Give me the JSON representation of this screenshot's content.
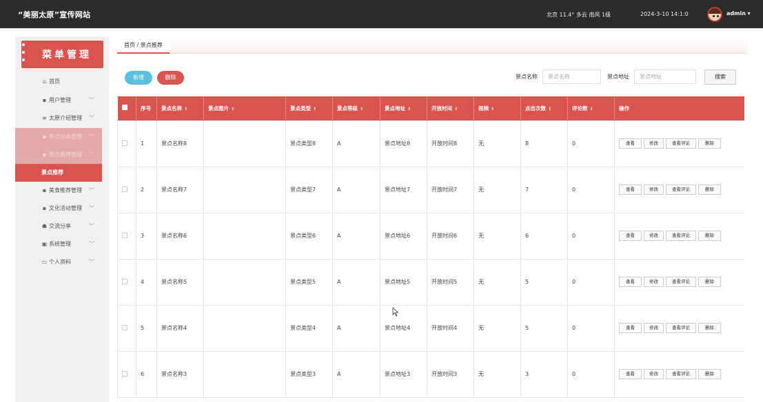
{
  "header": {
    "site_title": "“美丽太原”宣传网站",
    "weather": "北京 11.4° 多云 南风 1级",
    "datetime": "2024-3-10 14:1:0",
    "user": "admin ▾"
  },
  "sidebar": {
    "menu_title": "菜单管理",
    "items": [
      {
        "label": "首页",
        "icon": "home-icon",
        "chevron": ""
      },
      {
        "label": "用户管理",
        "icon": "grid-icon",
        "chevron": "﹀"
      },
      {
        "label": "太原介绍管理",
        "icon": "list-icon",
        "chevron": "﹀"
      },
      {
        "label": "景点分类管理",
        "icon": "grid-icon",
        "chevron": "﹀"
      },
      {
        "label": "景点推荐管理",
        "icon": "grid-icon",
        "chevron": "﹀"
      },
      {
        "label": "景点推荐",
        "icon": "",
        "chevron": ""
      },
      {
        "label": "美食推荐管理",
        "icon": "grid-icon",
        "chevron": "﹀"
      },
      {
        "label": "文化活动管理",
        "icon": "grid-icon",
        "chevron": "﹀"
      },
      {
        "label": "交流分享",
        "icon": "share-icon",
        "chevron": "﹀"
      },
      {
        "label": "系统管理",
        "icon": "system-icon",
        "chevron": "﹀"
      },
      {
        "label": "个人资料",
        "icon": "profile-icon",
        "chevron": "﹀"
      }
    ]
  },
  "breadcrumb": "首页 / 景点推荐",
  "toolbar": {
    "add_label": "新增",
    "delete_label": "删除",
    "name_label": "景点名称",
    "name_placeholder": "景点名称",
    "address_label": "景点地址",
    "address_placeholder": "景点地址",
    "search_label": "搜索"
  },
  "table": {
    "columns": [
      "序号",
      "景点名称",
      "景点图片",
      "景点类型",
      "景点等级",
      "景点地址",
      "开放时间",
      "视频",
      "点击次数",
      "评论数",
      "操作"
    ],
    "rows": [
      {
        "no": "1",
        "name": "景点名称8",
        "image": "",
        "type": "景点类型8",
        "level": "A",
        "address": "景点地址8",
        "open": "开放时间8",
        "video": "无",
        "clicks": "8",
        "comments": "0"
      },
      {
        "no": "2",
        "name": "景点名称7",
        "image": "",
        "type": "景点类型7",
        "level": "A",
        "address": "景点地址7",
        "open": "开放时间7",
        "video": "无",
        "clicks": "7",
        "comments": "0"
      },
      {
        "no": "3",
        "name": "景点名称6",
        "image": "",
        "type": "景点类型6",
        "level": "A",
        "address": "景点地址6",
        "open": "开放时间6",
        "video": "无",
        "clicks": "6",
        "comments": "0"
      },
      {
        "no": "4",
        "name": "景点名称5",
        "image": "",
        "type": "景点类型5",
        "level": "A",
        "address": "景点地址5",
        "open": "开放时间5",
        "video": "无",
        "clicks": "5",
        "comments": "0"
      },
      {
        "no": "5",
        "name": "景点名称4",
        "image": "",
        "type": "景点类型4",
        "level": "A",
        "address": "景点地址4",
        "open": "开放时间4",
        "video": "无",
        "clicks": "5",
        "comments": "0"
      },
      {
        "no": "6",
        "name": "景点名称3",
        "image": "",
        "type": "景点类型3",
        "level": "A",
        "address": "景点地址3",
        "open": "开放时间3",
        "video": "无",
        "clicks": "3",
        "comments": "0"
      }
    ],
    "actions": [
      "查看",
      "修改",
      "查看评论",
      "删除"
    ]
  },
  "colors": {
    "accent": "#d9534f",
    "info": "#5bc0de",
    "topbar": "#2b2b2b"
  }
}
